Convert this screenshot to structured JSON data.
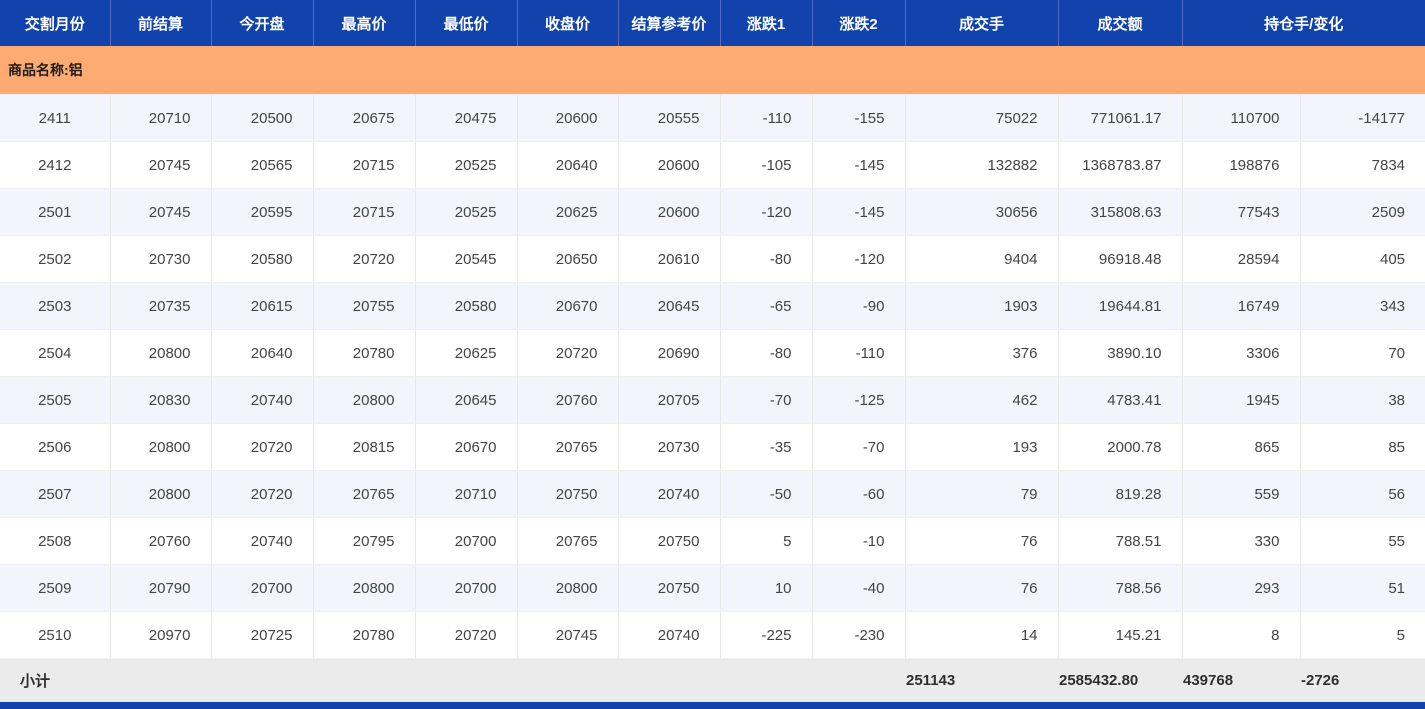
{
  "colors": {
    "header_bg": "#1243ad",
    "group_row_bg": "#fdab72",
    "row_alt_bg": "#f2f5fb",
    "subtotal_bg": "#ebebeb",
    "header_text": "#ffffff",
    "cell_text": "#444444"
  },
  "table": {
    "header": [
      "交割月份",
      "前结算",
      "今开盘",
      "最高价",
      "最低价",
      "收盘价",
      "结算参考价",
      "涨跌1",
      "涨跌2",
      "成交手",
      "成交额",
      "持仓手/变化"
    ],
    "group_label": "商品名称:铝",
    "rows": [
      [
        "2411",
        "20710",
        "20500",
        "20675",
        "20475",
        "20600",
        "20555",
        "-110",
        "-155",
        "75022",
        "771061.17",
        "110700",
        "-14177"
      ],
      [
        "2412",
        "20745",
        "20565",
        "20715",
        "20525",
        "20640",
        "20600",
        "-105",
        "-145",
        "132882",
        "1368783.87",
        "198876",
        "7834"
      ],
      [
        "2501",
        "20745",
        "20595",
        "20715",
        "20525",
        "20625",
        "20600",
        "-120",
        "-145",
        "30656",
        "315808.63",
        "77543",
        "2509"
      ],
      [
        "2502",
        "20730",
        "20580",
        "20720",
        "20545",
        "20650",
        "20610",
        "-80",
        "-120",
        "9404",
        "96918.48",
        "28594",
        "405"
      ],
      [
        "2503",
        "20735",
        "20615",
        "20755",
        "20580",
        "20670",
        "20645",
        "-65",
        "-90",
        "1903",
        "19644.81",
        "16749",
        "343"
      ],
      [
        "2504",
        "20800",
        "20640",
        "20780",
        "20625",
        "20720",
        "20690",
        "-80",
        "-110",
        "376",
        "3890.10",
        "3306",
        "70"
      ],
      [
        "2505",
        "20830",
        "20740",
        "20800",
        "20645",
        "20760",
        "20705",
        "-70",
        "-125",
        "462",
        "4783.41",
        "1945",
        "38"
      ],
      [
        "2506",
        "20800",
        "20720",
        "20815",
        "20670",
        "20765",
        "20730",
        "-35",
        "-70",
        "193",
        "2000.78",
        "865",
        "85"
      ],
      [
        "2507",
        "20800",
        "20720",
        "20765",
        "20710",
        "20750",
        "20740",
        "-50",
        "-60",
        "79",
        "819.28",
        "559",
        "56"
      ],
      [
        "2508",
        "20760",
        "20740",
        "20795",
        "20700",
        "20765",
        "20750",
        "5",
        "-10",
        "76",
        "788.51",
        "330",
        "55"
      ],
      [
        "2509",
        "20790",
        "20700",
        "20800",
        "20700",
        "20800",
        "20750",
        "10",
        "-40",
        "76",
        "788.56",
        "293",
        "51"
      ],
      [
        "2510",
        "20970",
        "20725",
        "20780",
        "20720",
        "20745",
        "20740",
        "-225",
        "-230",
        "14",
        "145.21",
        "8",
        "5"
      ]
    ],
    "subtotal_values": [
      "小计",
      "",
      "",
      "",
      "",
      "",
      "",
      "",
      "",
      "251143",
      "2585432.80",
      "439768",
      "-2726"
    ]
  }
}
